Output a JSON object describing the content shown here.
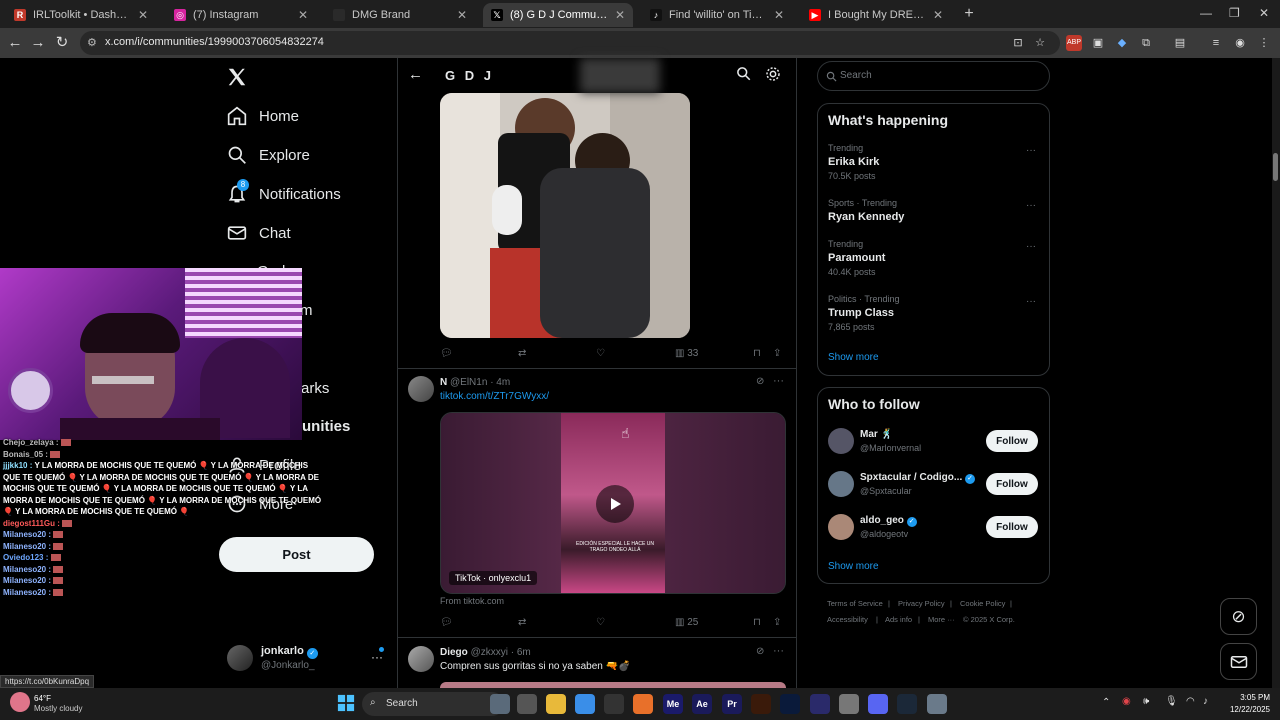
{
  "browser": {
    "tabs": [
      {
        "label": "IRLToolkit • Dashboard",
        "fav": "R",
        "favcolor": "#c0392b"
      },
      {
        "label": "(7) Instagram",
        "fav": "◎",
        "favcolor": "#d6249f"
      },
      {
        "label": "DMG Brand",
        "fav": "",
        "favcolor": "#2a2a2a"
      },
      {
        "label": "(8) G D J Community / X",
        "fav": "𝕏",
        "favcolor": "#000000"
      },
      {
        "label": "Find 'willito' on TikTok | TikTok S",
        "fav": "♪",
        "favcolor": "#111111"
      },
      {
        "label": "I Bought My DREAM HOUSE A",
        "fav": "▶",
        "favcolor": "#ff0000"
      }
    ],
    "url": "x.com/i/communities/1999003706054832274",
    "status_url": "https://t.co/0bKunraDpq"
  },
  "nav": {
    "home": "Home",
    "explore": "Explore",
    "notifications": "Notifications",
    "notif_badge": "8",
    "chat": "Chat",
    "grok_partial": "Grok",
    "communities_partial": "m",
    "bookmarks_partial": "arks",
    "communities2_partial": "unities",
    "profile": "Profile",
    "more": "More",
    "post": "Post",
    "account_name": "jonkarlo",
    "account_handle": "@Jonkarlo_"
  },
  "community": {
    "title": "G D J"
  },
  "posts": [
    {
      "actions": {
        "views": "33"
      }
    },
    {
      "author": "N",
      "handle": "@ElN1n",
      "time": "· 4m",
      "link": "tiktok.com/t/ZTr7GWyxx/",
      "card_label": "TikTok · onlyexclu1",
      "from": "From tiktok.com",
      "overlay_text": "EDICIÓN ESPECIAL LE HACE UN TRAGO ONDEO ALLÁ",
      "actions": {
        "views": "25"
      }
    },
    {
      "author": "Diego",
      "handle": "@zkxxyi",
      "time": "· 6m",
      "text": "Compren sus gorritas si no ya saben 🔫💣"
    }
  ],
  "right": {
    "search_placeholder": "Search",
    "happening_title": "What's happening",
    "trends": [
      {
        "cat": "Trending",
        "name": "Erika Kirk",
        "count": "70.5K posts"
      },
      {
        "cat": "Sports · Trending",
        "name": "Ryan Kennedy",
        "count": ""
      },
      {
        "cat": "Trending",
        "name": "Paramount",
        "count": "40.4K posts"
      },
      {
        "cat": "Politics · Trending",
        "name": "Trump Class",
        "count": "7,865 posts"
      }
    ],
    "show_more": "Show more",
    "follow_title": "Who to follow",
    "follow": [
      {
        "name": "Mar 🕺",
        "handle": "@Marlonvernal",
        "verified": false
      },
      {
        "name": "Spxtacular / Codigo...",
        "handle": "@Spxtacular",
        "verified": true
      },
      {
        "name": "aldo_geo",
        "handle": "@aldogeotv",
        "verified": true
      }
    ],
    "follow_btn": "Follow",
    "footer": {
      "terms": "Terms of Service",
      "privacy": "Privacy Policy",
      "cookie": "Cookie Policy",
      "access": "Accessibility",
      "ads": "Ads info",
      "more": "More ···",
      "copy": "© 2025 X Corp."
    }
  },
  "chat": [
    {
      "user": "Chejo_zelaya :",
      "msg": "",
      "color": "#bbbbbb"
    },
    {
      "user": "Bonais_05 :",
      "msg": "",
      "color": "#bbbbbb"
    },
    {
      "user": "jjjkk10 :",
      "msg": "Y LA MORRA DE MOCHIS QUE TE QUEMÓ 🎈 Y LA MORRA DE MOCHIS",
      "color": "#8fdfff"
    },
    {
      "user": "",
      "msg": "QUE TE QUEMÓ 🎈 Y LA MORRA DE MOCHIS QUE TE QUEMÓ 🎈 Y LA MORRA DE",
      "color": "#fff"
    },
    {
      "user": "",
      "msg": "MOCHIS QUE TE QUEMÓ 🎈 Y LA MORRA DE MOCHIS QUE TE QUEMÓ 🎈 Y LA",
      "color": "#fff"
    },
    {
      "user": "",
      "msg": "MORRA DE MOCHIS QUE TE QUEMÓ 🎈 Y LA MORRA DE MOCHIS QUE TE QUEMÓ",
      "color": "#fff"
    },
    {
      "user": "",
      "msg": "🎈 Y LA MORRA DE MOCHIS QUE TE QUEMÓ 🎈",
      "color": "#fff"
    },
    {
      "user": "diegost111Gu :",
      "msg": "",
      "color": "#ff5a5a"
    },
    {
      "user": "Milaneso20 :",
      "msg": "",
      "color": "#8fb4ff"
    },
    {
      "user": "Milaneso20 :",
      "msg": "",
      "color": "#8fb4ff"
    },
    {
      "user": "Oviedo123 :",
      "msg": "",
      "color": "#6fa8ff"
    },
    {
      "user": "Milaneso20 :",
      "msg": "",
      "color": "#8fb4ff"
    },
    {
      "user": "Milaneso20 :",
      "msg": "",
      "color": "#8fb4ff"
    },
    {
      "user": "Milaneso20 :",
      "msg": "",
      "color": "#8fb4ff"
    }
  ],
  "taskbar": {
    "weather_temp": "64°F",
    "weather_desc": "Mostly cloudy",
    "search": "Search",
    "time": "3:05 PM",
    "date": "12/22/2025"
  }
}
